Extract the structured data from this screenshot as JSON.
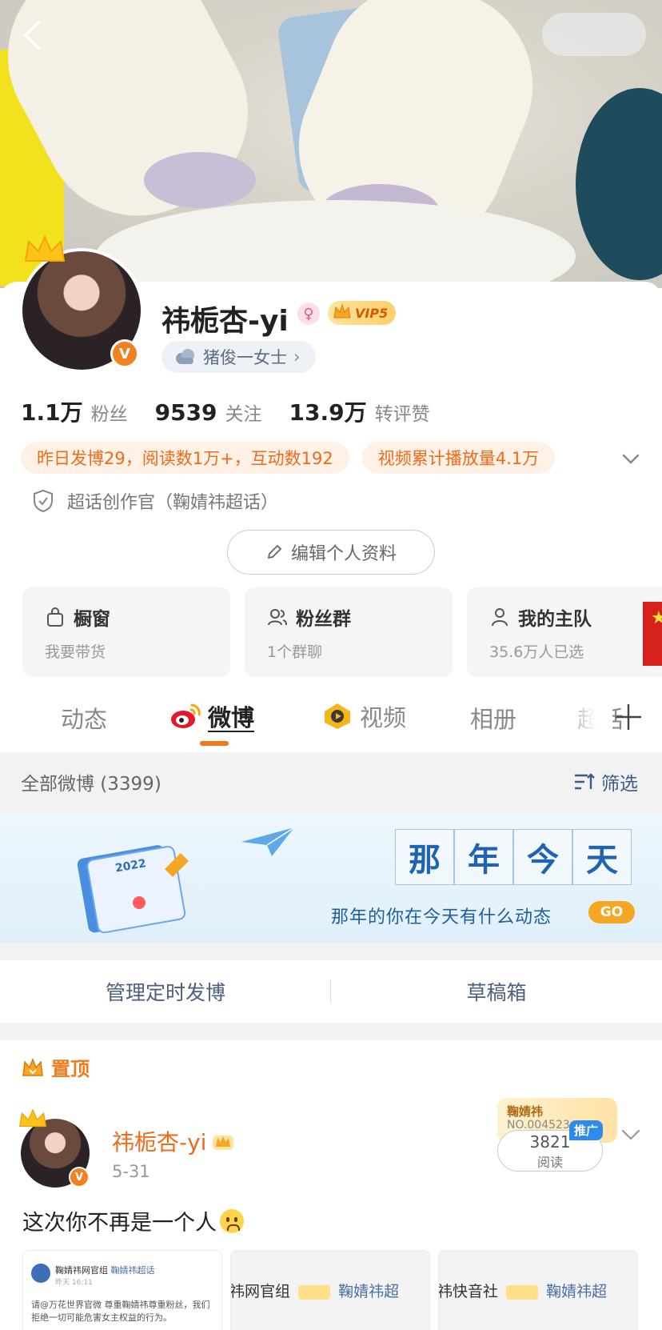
{
  "profile": {
    "name": "祎栀杏-yi",
    "vip": "VIP5",
    "tag": "猪俊一女士",
    "stats": [
      {
        "num": "1.1万",
        "label": "粉丝"
      },
      {
        "num": "9539",
        "label": "关注"
      },
      {
        "num": "13.9万",
        "label": "转评赞"
      }
    ],
    "highlights": [
      "昨日发博29，阅读数1万+，互动数192",
      "视频累计播放量4.1万"
    ],
    "super_topic": "超话创作官（鞠婧祎超话）",
    "edit_label": "编辑个人资料",
    "features": [
      {
        "title": "橱窗",
        "sub": "我要带货"
      },
      {
        "title": "粉丝群",
        "sub": "1个群聊"
      },
      {
        "title": "我的主队",
        "sub": "35.6万人已选"
      }
    ]
  },
  "tabs": [
    "动态",
    "微博",
    "视频",
    "相册",
    "超话"
  ],
  "active_tab": "微博",
  "filter_bar": {
    "count": "全部微博 (3399)",
    "filter": "筛选"
  },
  "banner": {
    "title_chars": [
      "那",
      "年",
      "今",
      "天"
    ],
    "calendar_year": "2022",
    "subtitle": "那年的你在今天有什么动态",
    "go": "GO"
  },
  "manage": {
    "scheduled": "管理定时发博",
    "drafts": "草稿箱"
  },
  "pinned_label": "置顶",
  "post": {
    "author": "祎栀杏-yi",
    "date": "5-31",
    "promo_title": "鞠婧祎",
    "promo_no": "NO.004523",
    "reads": "3821",
    "reads_label": "阅读",
    "promo_tag": "推广",
    "text": "这次你不再是一个人",
    "thumbs": [
      {
        "head": "鞠婧祎网官组",
        "topic": "鞠婧祎超话",
        "body": "请@万花世界官微 尊重鞠婧祎尊重粉丝，我们拒绝一切可能危害女主权益的行为。",
        "time": "昨天 16:11"
      },
      {
        "prefix": "祎网官组",
        "topic": "鞠婧祎超"
      },
      {
        "prefix": "祎快音社",
        "topic": "鞠婧祎超"
      }
    ]
  },
  "colors": {
    "accent": "#f27a1a",
    "link": "#3d5c8a",
    "banner_blue": "#1f63b4"
  }
}
